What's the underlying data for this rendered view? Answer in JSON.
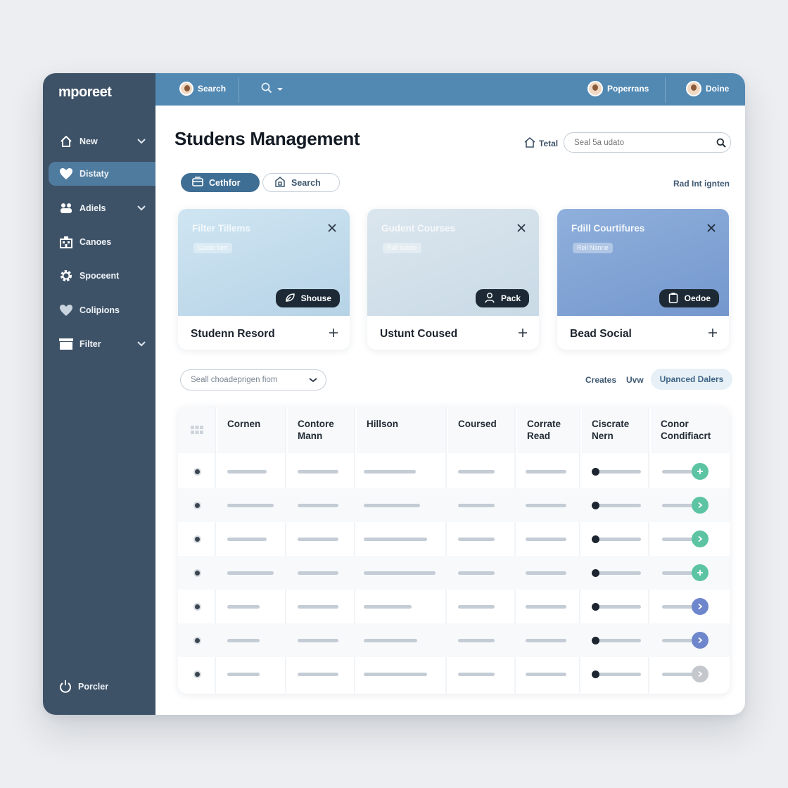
{
  "brand": {
    "name": "mporeet"
  },
  "sidebar": {
    "items": [
      {
        "label": "New",
        "icon": "home-icon",
        "chevron": true
      },
      {
        "label": "Distaty",
        "icon": "heart-icon",
        "chevron": false,
        "active": true
      },
      {
        "label": "Adiels",
        "icon": "users-icon",
        "chevron": true
      },
      {
        "label": "Canoes",
        "icon": "building-icon",
        "chevron": false
      },
      {
        "label": "Spoceent",
        "icon": "gear-icon",
        "chevron": false
      },
      {
        "label": "Colipions",
        "icon": "heart-icon",
        "chevron": false
      },
      {
        "label": "Filter",
        "icon": "folder-icon",
        "chevron": true
      }
    ],
    "footer": {
      "label": "Porcler",
      "icon": "power-icon"
    }
  },
  "topbar": {
    "search_label": "Search",
    "user1": "Poperrans",
    "user2": "Doine"
  },
  "page": {
    "title": "Studens Management",
    "total_label": "Tetal",
    "search_placeholder": "Seal 5a udato",
    "primary_pill": "Cethfor",
    "outline_pill": "Search",
    "right_link": "Rad Int ignten"
  },
  "cards": [
    {
      "title": "Filter Tillems",
      "tag": "Garde tiert",
      "button": "Shouse",
      "button_icon": "leaf-icon",
      "footer": "Studenn Resord",
      "color": "#c6deee"
    },
    {
      "title": "Gudent Courses",
      "tag": "Rafi solete",
      "button": "Pack",
      "button_icon": "person-icon",
      "footer": "Ustunt Coused",
      "color": "#d2e0ea"
    },
    {
      "title": "Fdill Courtifures",
      "tag": "Rell Nanne",
      "button": "Oedoe",
      "button_icon": "clipboard-icon",
      "footer": "Bead Social",
      "color": "#7fa1d2"
    }
  ],
  "filters": {
    "select_value": "Seall choadeprigen fiom",
    "link1": "Creates",
    "link2": "Uvw",
    "pill": "Upanced Dalers"
  },
  "table": {
    "headers": [
      "Cornen",
      "Contore Mann",
      "Hillson",
      "Coursed",
      "Corrate Read",
      "Ciscrate Nern",
      "Conor Condifiacrt"
    ],
    "rows": [
      {
        "status_color": "#5cc4a2",
        "action": "plus"
      },
      {
        "status_color": "#5cc4a2",
        "action": "chevron"
      },
      {
        "status_color": "#5cc4a2",
        "action": "chevron"
      },
      {
        "status_color": "#5cc4a2",
        "action": "plus"
      },
      {
        "status_color": "#6d86cc",
        "action": "chevron"
      },
      {
        "status_color": "#6d86cc",
        "action": "chevron"
      },
      {
        "status_color": "#c4c8cd",
        "action": "chevron"
      }
    ]
  },
  "colors": {
    "sidebar": "#3e5267",
    "topbar": "#5289b3",
    "accent": "#3f6e94"
  }
}
